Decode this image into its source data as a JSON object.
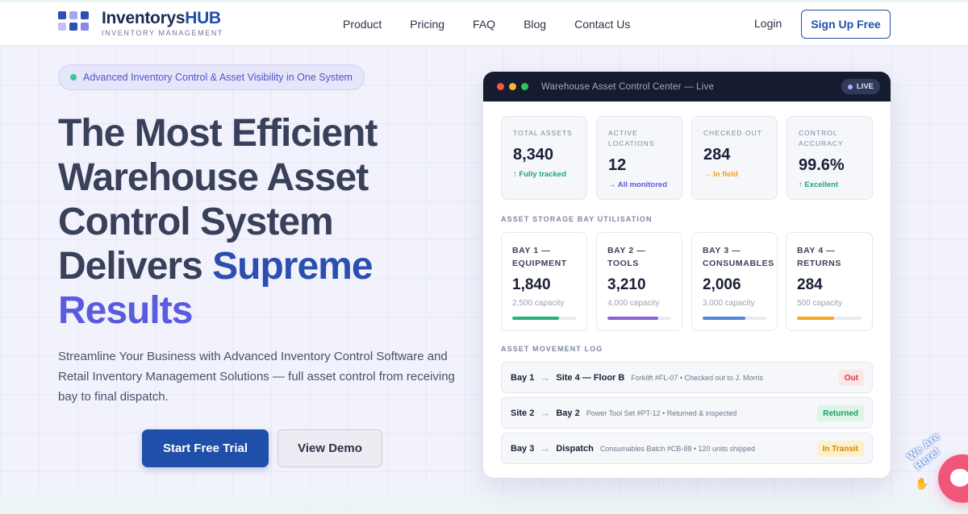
{
  "brand": {
    "name_part1": "Inventorys",
    "name_part2": "HUB",
    "tagline": "INVENTORY MANAGEMENT",
    "colors": {
      "primary": "#1f4fa8",
      "accent": "#5b5bde",
      "dark": "#161c2f"
    }
  },
  "nav": {
    "items": [
      {
        "label": "Product"
      },
      {
        "label": "Pricing"
      },
      {
        "label": "FAQ"
      },
      {
        "label": "Blog"
      },
      {
        "label": "Contact Us"
      }
    ],
    "login_label": "Login",
    "signup_label": "Sign Up Free"
  },
  "hero": {
    "badge": "Advanced Inventory Control & Asset Visibility in One System",
    "title_line1": "The Most Efficient",
    "title_line2": "Warehouse Asset",
    "title_line3": "Control System",
    "title_line4_plain": "Delivers ",
    "title_line4_accent": "Supreme",
    "title_line5_accent": "Results",
    "description": "Streamline Your Business with Advanced Inventory Control Software and Retail Inventory Management Solutions — full asset control from receiving bay to final dispatch.",
    "cta_primary": "Start Free Trial",
    "cta_secondary": "View Demo"
  },
  "dashboard": {
    "title": "Warehouse Asset Control Center — Live",
    "live_label": "LIVE",
    "stats": [
      {
        "label": "TOTAL ASSETS",
        "value": "8,340",
        "note": "↑ Fully tracked",
        "note_color": "#1ea672"
      },
      {
        "label": "ACTIVE LOCATIONS",
        "value": "12",
        "note": "→ All monitored",
        "note_color": "#5b5bde"
      },
      {
        "label": "CHECKED OUT",
        "value": "284",
        "note": "→ In field",
        "note_color": "#f0a21a"
      },
      {
        "label": "CONTROL ACCURACY",
        "value": "99.6%",
        "note": "↑ Excellent",
        "note_color": "#1ea672"
      }
    ],
    "bay_section_label": "ASSET STORAGE BAY UTILISATION",
    "bays": [
      {
        "label": "BAY 1 — EQUIPMENT",
        "value": "1,840",
        "capacity": "2,500 capacity",
        "fill": 0.736,
        "color": "#22b573"
      },
      {
        "label": "BAY 2 — TOOLS",
        "value": "3,210",
        "capacity": "4,000 capacity",
        "fill": 0.8,
        "color": "#8b63d9"
      },
      {
        "label": "BAY 3 — CONSUMABLES",
        "value": "2,006",
        "capacity": "3,000 capacity",
        "fill": 0.67,
        "color": "#4f86d8"
      },
      {
        "label": "BAY 4 — RETURNS",
        "value": "284",
        "capacity": "500 capacity",
        "fill": 0.57,
        "color": "#f5a623"
      }
    ],
    "log_section_label": "ASSET MOVEMENT LOG",
    "log": [
      {
        "from": "Bay 1",
        "to": "Site 4 — Floor B",
        "desc": "Forklift #FL-07 • Checked out to J. Morris",
        "status": "Out",
        "status_bg": "#fde5e5",
        "status_fg": "#d93b3b"
      },
      {
        "from": "Site 2",
        "to": "Bay 2",
        "desc": "Power Tool Set #PT-12 • Returned & inspected",
        "status": "Returned",
        "status_bg": "#dcf5e8",
        "status_fg": "#1e9b62"
      },
      {
        "from": "Bay 3",
        "to": "Dispatch",
        "desc": "Consumables Batch #CB-88 • 120 units shipped",
        "status": "In Transit",
        "status_bg": "#fdf1cc",
        "status_fg": "#d08a0c"
      }
    ]
  },
  "chat": {
    "label": "We Are Here!"
  }
}
